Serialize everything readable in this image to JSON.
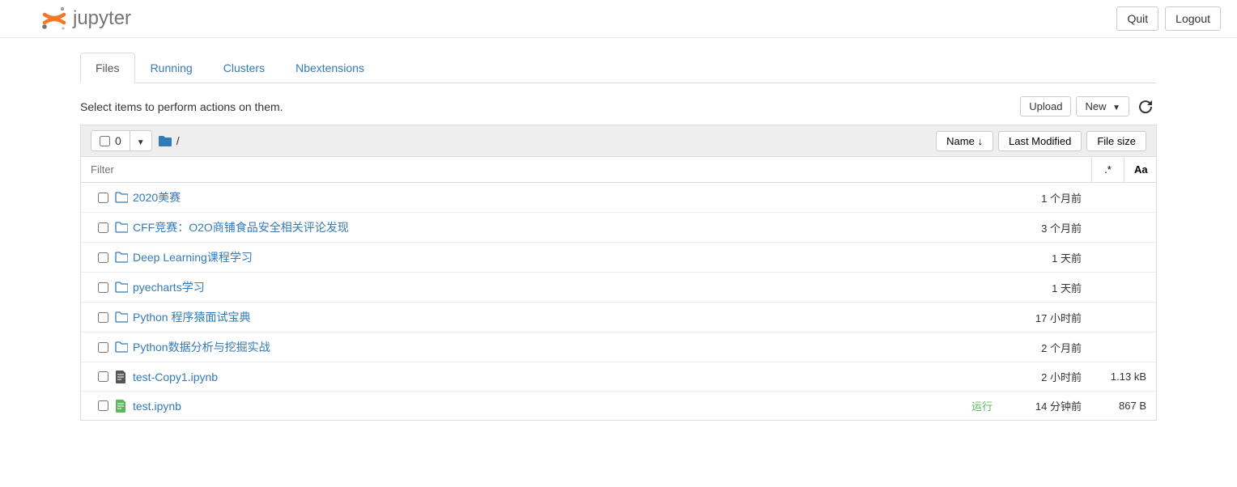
{
  "header": {
    "logo_text": "jupyter",
    "quit": "Quit",
    "logout": "Logout"
  },
  "tabs": [
    {
      "label": "Files",
      "active": true
    },
    {
      "label": "Running",
      "active": false
    },
    {
      "label": "Clusters",
      "active": false
    },
    {
      "label": "Nbextensions",
      "active": false
    }
  ],
  "toolbar": {
    "hint": "Select items to perform actions on them.",
    "upload": "Upload",
    "new": "New"
  },
  "list_header": {
    "selected_count": "0",
    "breadcrumb": "/",
    "name": "Name",
    "last_modified": "Last Modified",
    "file_size": "File size"
  },
  "filter": {
    "placeholder": "Filter",
    "regex_btn": ".*",
    "case_btn": "Aa"
  },
  "files": [
    {
      "type": "folder",
      "name": "2020美赛",
      "modified": "1 个月前",
      "size": "",
      "status": ""
    },
    {
      "type": "folder",
      "name": "CFF竞赛：O2O商铺食品安全相关评论发现",
      "modified": "3 个月前",
      "size": "",
      "status": ""
    },
    {
      "type": "folder",
      "name": "Deep Learning课程学习",
      "modified": "1 天前",
      "size": "",
      "status": ""
    },
    {
      "type": "folder",
      "name": "pyecharts学习",
      "modified": "1 天前",
      "size": "",
      "status": ""
    },
    {
      "type": "folder",
      "name": "Python 程序猿面试宝典",
      "modified": "17 小时前",
      "size": "",
      "status": ""
    },
    {
      "type": "folder",
      "name": "Python数据分析与挖掘实战",
      "modified": "2 个月前",
      "size": "",
      "status": ""
    },
    {
      "type": "notebook",
      "name": "test-Copy1.ipynb",
      "modified": "2 小时前",
      "size": "1.13 kB",
      "status": ""
    },
    {
      "type": "notebook-running",
      "name": "test.ipynb",
      "modified": "14 分钟前",
      "size": "867 B",
      "status": "运行"
    }
  ]
}
